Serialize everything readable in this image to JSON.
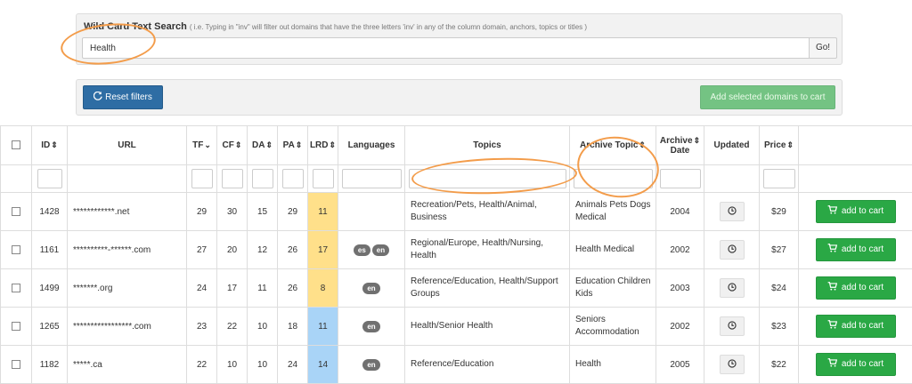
{
  "search": {
    "label": "Wild Card Text Search",
    "hint": "( i.e. Typing in \"inv\" will filter out domains that have the three letters 'inv' in any of the column domain, anchors, topics or titles )",
    "value": "Health",
    "go_label": "Go!"
  },
  "filters": {
    "reset_label": "Reset filters",
    "add_selected_label": "Add selected domains to cart"
  },
  "table": {
    "headers": {
      "id": "ID",
      "url": "URL",
      "tf": "TF",
      "cf": "CF",
      "da": "DA",
      "pa": "PA",
      "lrd": "LRD",
      "languages": "Languages",
      "topics": "Topics",
      "archive_topic": "Archive Topic",
      "archive_date_1": "Archive",
      "archive_date_2": "Date",
      "updated": "Updated",
      "price": "Price"
    },
    "rows": [
      {
        "id": "1428",
        "url": "************.net",
        "tf": "29",
        "cf": "30",
        "da": "15",
        "pa": "29",
        "lrd": "11",
        "lrd_color": "#ffe08a",
        "langs": [],
        "topics": "Recreation/Pets, Health/Animal, Business",
        "archive_topic": "Animals Pets Dogs Medical",
        "archive_date": "2004",
        "price": "$29",
        "add_label": "add to cart"
      },
      {
        "id": "1161",
        "url": "**********-******.com",
        "tf": "27",
        "cf": "20",
        "da": "12",
        "pa": "26",
        "lrd": "17",
        "lrd_color": "#ffe08a",
        "langs": [
          "es",
          "en"
        ],
        "topics": "Regional/Europe, Health/Nursing, Health",
        "archive_topic": "Health Medical",
        "archive_date": "2002",
        "price": "$27",
        "add_label": "add to cart"
      },
      {
        "id": "1499",
        "url": "*******.org",
        "tf": "24",
        "cf": "17",
        "da": "11",
        "pa": "26",
        "lrd": "8",
        "lrd_color": "#ffe08a",
        "langs": [
          "en"
        ],
        "topics": "Reference/Education, Health/Support Groups",
        "archive_topic": "Education Children Kids",
        "archive_date": "2003",
        "price": "$24",
        "add_label": "add to cart"
      },
      {
        "id": "1265",
        "url": "*****************.com",
        "tf": "23",
        "cf": "22",
        "da": "10",
        "pa": "18",
        "lrd": "11",
        "lrd_color": "#a9d4f7",
        "langs": [
          "en"
        ],
        "topics": "Health/Senior Health",
        "archive_topic": "Seniors Accommodation",
        "archive_date": "2002",
        "price": "$23",
        "add_label": "add to cart"
      },
      {
        "id": "1182",
        "url": "*****.ca",
        "tf": "22",
        "cf": "10",
        "da": "10",
        "pa": "24",
        "lrd": "14",
        "lrd_color": "#a9d4f7",
        "langs": [
          "en"
        ],
        "topics": "Reference/Education",
        "archive_topic": "Health",
        "archive_date": "2005",
        "price": "$22",
        "add_label": "add to cart"
      }
    ]
  },
  "icons": {
    "reset": "refresh-icon",
    "cart": "cart-icon",
    "updated": "clock-icon",
    "sort": "sort-icon",
    "sort_desc": "sort-desc-icon"
  },
  "colors": {
    "primary": "#2e6da4",
    "success": "#2aa845",
    "lrd_warm": "#ffe08a",
    "lrd_cool": "#a9d4f7",
    "annotation": "#f39c4a"
  }
}
